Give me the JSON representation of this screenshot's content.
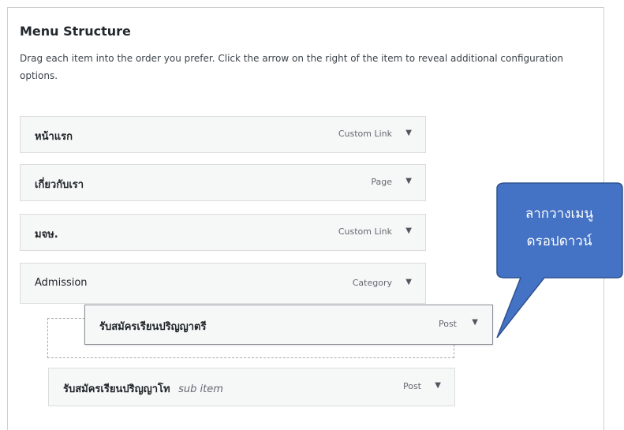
{
  "panel": {
    "title": "Menu Structure",
    "description": "Drag each item into the order you prefer. Click the arrow on the right of the item to reveal additional configuration options."
  },
  "menu_items": [
    {
      "label": "หน้าแรก",
      "type": "Custom Link"
    },
    {
      "label": "เกี่ยวกับเรา",
      "type": "Page"
    },
    {
      "label": "มจษ.",
      "type": "Custom Link"
    },
    {
      "label": "Admission",
      "type": "Category"
    }
  ],
  "dragging_item": {
    "label": "รับสมัครเรียนปริญญาตรี",
    "type": "Post"
  },
  "sub_item": {
    "label": "รับสมัครเรียนปริญญาโท",
    "subtext": "sub item",
    "type": "Post"
  },
  "arrow_glyph": "▼",
  "callout": {
    "line1": "ลากวางเมนู",
    "line2": "ดรอปดาวน์",
    "fill_color": "#4472c4",
    "border_color": "#2f528f"
  }
}
